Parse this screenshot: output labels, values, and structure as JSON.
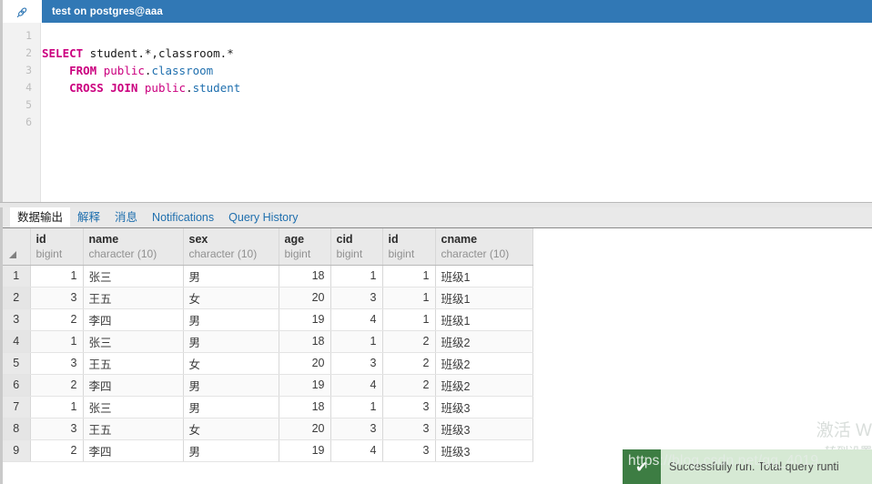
{
  "titlebar": {
    "icon": "query-tool-icon",
    "tab_title": "test on postgres@aaa"
  },
  "editor": {
    "line_numbers": [
      "1",
      "2",
      "3",
      "4",
      "5",
      "6"
    ],
    "lines": [
      {
        "n": 1,
        "tokens": []
      },
      {
        "n": 2,
        "tokens": [
          {
            "t": "SELECT",
            "c": "kw"
          },
          {
            "t": " student.*,classroom.*",
            "c": "plain"
          }
        ]
      },
      {
        "n": 3,
        "tokens": [
          {
            "t": "    ",
            "c": "plain"
          },
          {
            "t": "FROM",
            "c": "kw"
          },
          {
            "t": " ",
            "c": "plain"
          },
          {
            "t": "public",
            "c": "sch"
          },
          {
            "t": ".",
            "c": "plain"
          },
          {
            "t": "classroom",
            "c": "tbl"
          }
        ]
      },
      {
        "n": 4,
        "tokens": [
          {
            "t": "    ",
            "c": "plain"
          },
          {
            "t": "CROSS JOIN",
            "c": "kw"
          },
          {
            "t": " ",
            "c": "plain"
          },
          {
            "t": "public",
            "c": "sch"
          },
          {
            "t": ".",
            "c": "plain"
          },
          {
            "t": "student",
            "c": "tbl"
          }
        ]
      },
      {
        "n": 5,
        "tokens": []
      },
      {
        "n": 6,
        "tokens": []
      }
    ],
    "sql_text": "SELECT student.*,classroom.*\n    FROM public.classroom\n    CROSS JOIN public.student"
  },
  "result_tabs": [
    {
      "label": "数据输出",
      "active": true
    },
    {
      "label": "解释",
      "active": false
    },
    {
      "label": "消息",
      "active": false
    },
    {
      "label": "Notifications",
      "active": false
    },
    {
      "label": "Query History",
      "active": false
    }
  ],
  "grid": {
    "columns": [
      {
        "name": "id",
        "type": "bigint",
        "align": "num",
        "cls": "c-id1"
      },
      {
        "name": "name",
        "type": "character (10)",
        "align": "txt",
        "cls": "c-name"
      },
      {
        "name": "sex",
        "type": "character (10)",
        "align": "txt",
        "cls": "c-sex"
      },
      {
        "name": "age",
        "type": "bigint",
        "align": "num",
        "cls": "c-age"
      },
      {
        "name": "cid",
        "type": "bigint",
        "align": "num",
        "cls": "c-cid"
      },
      {
        "name": "id",
        "type": "bigint",
        "align": "num",
        "cls": "c-id2"
      },
      {
        "name": "cname",
        "type": "character (10)",
        "align": "txt",
        "cls": "c-cname"
      }
    ],
    "rows": [
      {
        "n": "1",
        "cells": [
          "1",
          "张三",
          "男",
          "18",
          "1",
          "1",
          "班级1"
        ]
      },
      {
        "n": "2",
        "cells": [
          "3",
          "王五",
          "女",
          "20",
          "3",
          "1",
          "班级1"
        ]
      },
      {
        "n": "3",
        "cells": [
          "2",
          "李四",
          "男",
          "19",
          "4",
          "1",
          "班级1"
        ]
      },
      {
        "n": "4",
        "cells": [
          "1",
          "张三",
          "男",
          "18",
          "1",
          "2",
          "班级2"
        ]
      },
      {
        "n": "5",
        "cells": [
          "3",
          "王五",
          "女",
          "20",
          "3",
          "2",
          "班级2"
        ]
      },
      {
        "n": "6",
        "cells": [
          "2",
          "李四",
          "男",
          "19",
          "4",
          "2",
          "班级2"
        ]
      },
      {
        "n": "7",
        "cells": [
          "1",
          "张三",
          "男",
          "18",
          "1",
          "3",
          "班级3"
        ]
      },
      {
        "n": "8",
        "cells": [
          "3",
          "王五",
          "女",
          "20",
          "3",
          "3",
          "班级3"
        ]
      },
      {
        "n": "9",
        "cells": [
          "2",
          "李四",
          "男",
          "19",
          "4",
          "3",
          "班级3"
        ]
      }
    ]
  },
  "toast": {
    "icon": "check-icon",
    "message": "Successfully run. Total query runti"
  },
  "watermarks": {
    "activate": "激活 W",
    "activate_sub": "转到设置",
    "url": "https://blog.csdn.net/qq_4019"
  },
  "colors": {
    "title_bar": "#3178b5",
    "tab_link": "#1f6fae",
    "keyword": "#cb007f",
    "table_name": "#1f6fae",
    "toast_bg": "#d6e9d4",
    "toast_icon_bg": "#3d7d43",
    "grid_header_bg": "#e9e9e9"
  }
}
